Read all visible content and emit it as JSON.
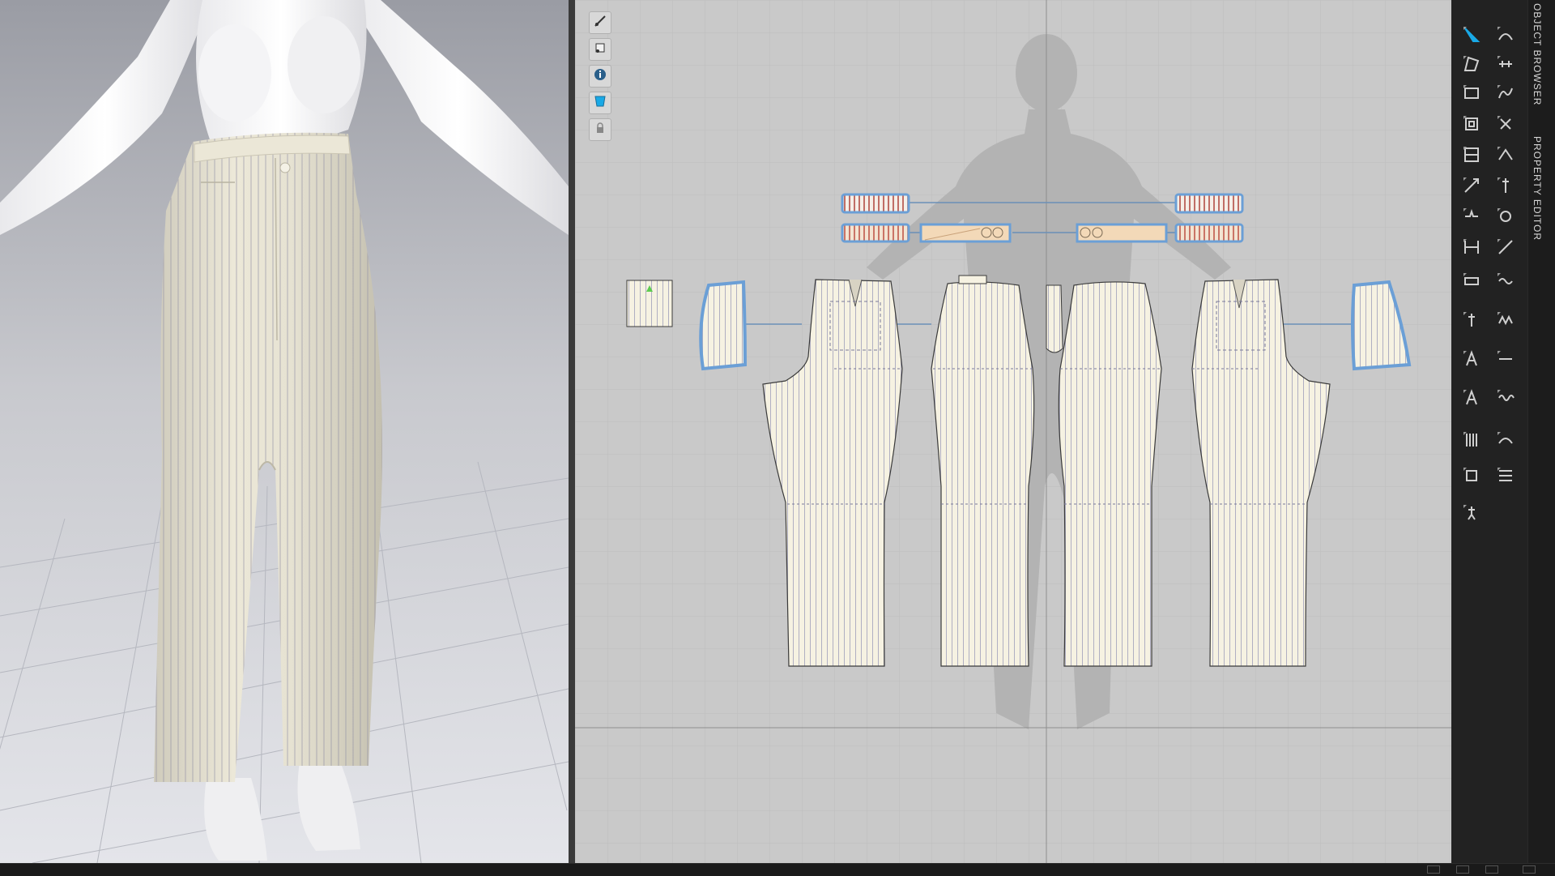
{
  "app": {
    "accent": "#19a9e6",
    "pattern_fabric_color": "#f6f2e2",
    "pinstripe_color": "#9a9ab4",
    "selection_outline_color": "#6b9fd6",
    "binding_strip_color": "#d86a3e"
  },
  "toolbar_2d": {
    "tools": [
      {
        "name": "pattern-view-toggle-icon"
      },
      {
        "name": "avatar-view-toggle-icon"
      },
      {
        "name": "info-icon"
      },
      {
        "name": "fabric-view-icon"
      },
      {
        "name": "lock-view-icon"
      }
    ]
  },
  "tabs": {
    "object_browser": "OBJECT BROWSER",
    "property_editor": "PROPERTY EDITOR"
  },
  "right_toolbar": {
    "tools": [
      "select-transform-icon",
      "edit-curve-icon",
      "polygon-icon",
      "sewing-segment-icon",
      "rectangle-icon",
      "free-sewing-icon",
      "internal-polygon-icon",
      "tack-icon",
      "trace-icon",
      "fold-icon",
      "knife-cut-icon",
      "pin-icon",
      "notch-icon",
      "button-icon",
      "segment-icon",
      "edit-pattern-icon",
      "measure-icon",
      "tape-icon",
      "ruler-icon",
      "zigzag-icon",
      "text-annotation-icon",
      "topstitch-icon",
      "text-icon",
      "wave-stitch-icon",
      "grain-icon",
      "puckering-icon",
      "texture-icon",
      "gradation-icon",
      "avatar-pose-icon"
    ]
  }
}
